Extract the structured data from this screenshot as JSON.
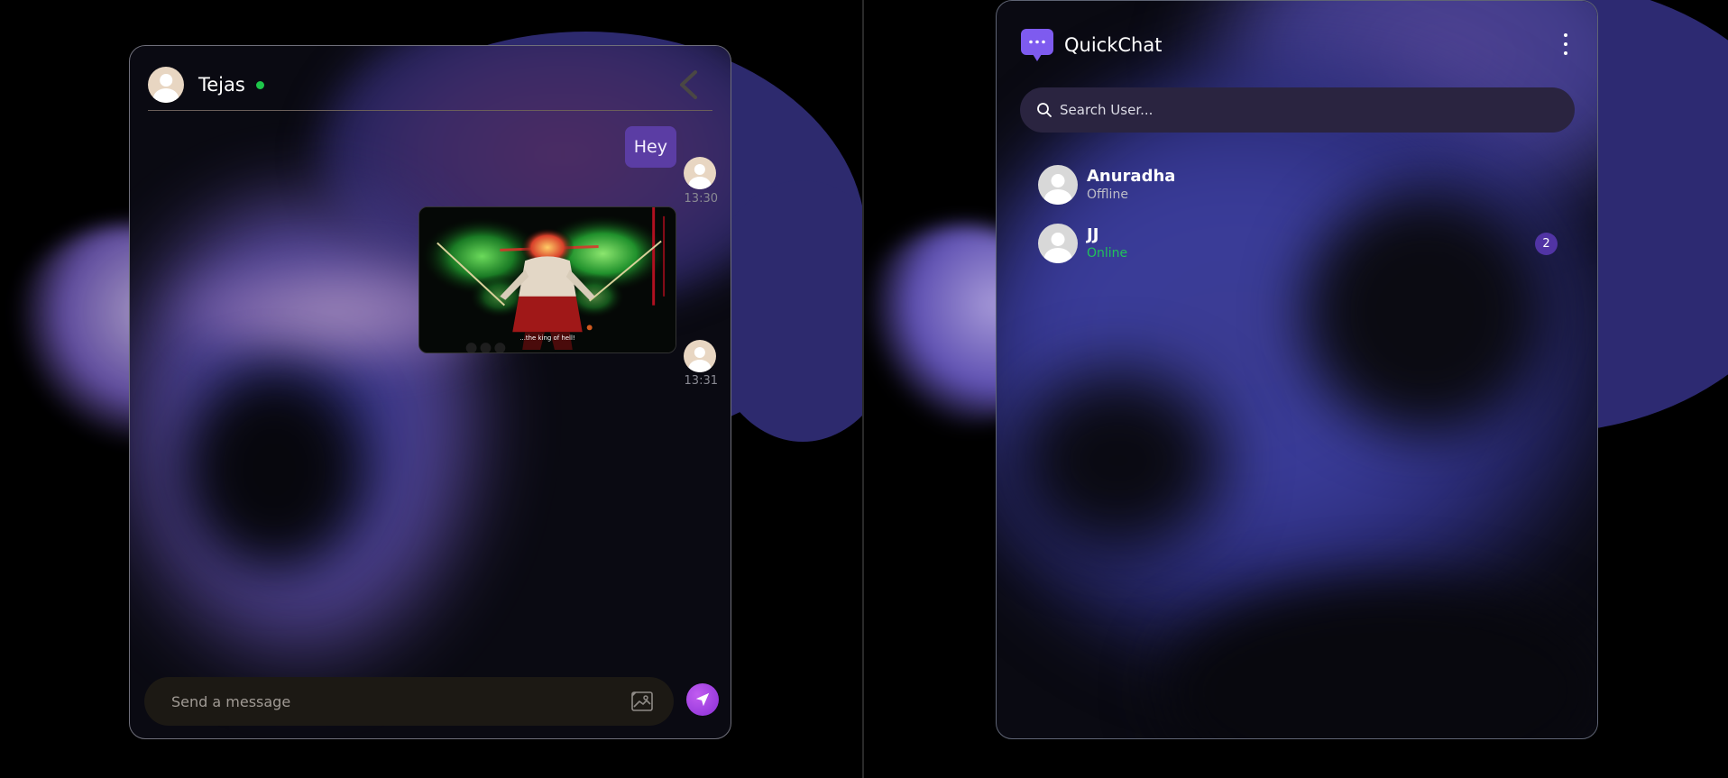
{
  "chat": {
    "contact_name": "Tejas",
    "messages": [
      {
        "type": "text",
        "text": "Hey",
        "time": "13:30"
      },
      {
        "type": "image",
        "caption": "...the king of hell!",
        "time": "13:31"
      }
    ],
    "composer": {
      "placeholder": "Send a message"
    }
  },
  "app": {
    "name": "QuickChat",
    "search": {
      "placeholder": "Search User..."
    },
    "users": [
      {
        "name": "Anuradha",
        "status": "Offline",
        "unread": null
      },
      {
        "name": "JJ",
        "status": "Online",
        "unread": "2"
      }
    ]
  },
  "colors": {
    "accent": "#5b3da4",
    "online": "#1ec64a",
    "send_button": "#a046e3"
  },
  "icons": {
    "back": "chevron-left-icon",
    "image": "image-icon",
    "send": "send-icon",
    "brand": "chat-bubble-icon",
    "menu": "more-vertical-icon",
    "search": "search-icon"
  }
}
